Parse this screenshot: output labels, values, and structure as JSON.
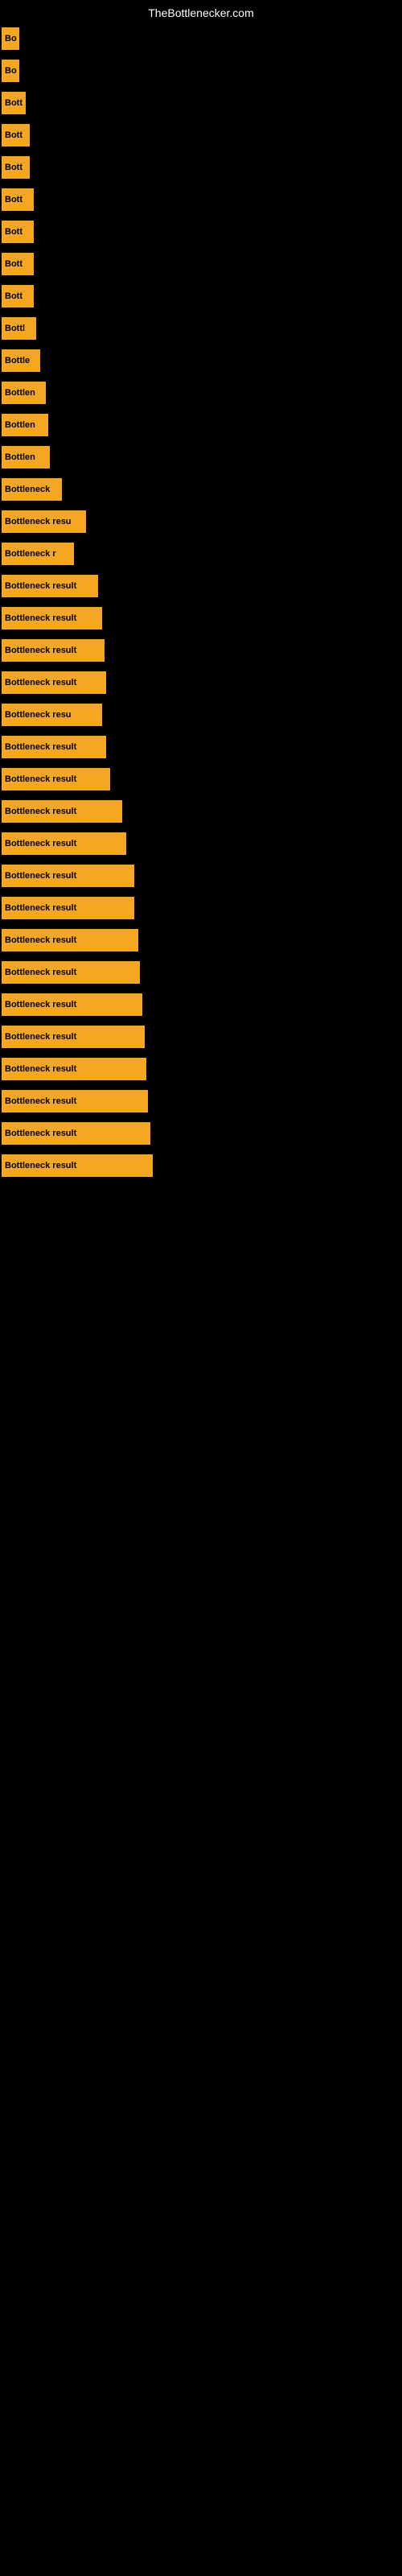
{
  "title": "TheBottlenecker.com",
  "bars": [
    {
      "label": "Bo",
      "width": 22
    },
    {
      "label": "Bo",
      "width": 22
    },
    {
      "label": "Bott",
      "width": 30
    },
    {
      "label": "Bott",
      "width": 35
    },
    {
      "label": "Bott",
      "width": 35
    },
    {
      "label": "Bott",
      "width": 40
    },
    {
      "label": "Bott",
      "width": 40
    },
    {
      "label": "Bott",
      "width": 40
    },
    {
      "label": "Bott",
      "width": 40
    },
    {
      "label": "Bottl",
      "width": 43
    },
    {
      "label": "Bottle",
      "width": 48
    },
    {
      "label": "Bottlen",
      "width": 55
    },
    {
      "label": "Bottlen",
      "width": 58
    },
    {
      "label": "Bottlen",
      "width": 60
    },
    {
      "label": "Bottleneck",
      "width": 75
    },
    {
      "label": "Bottleneck resu",
      "width": 105
    },
    {
      "label": "Bottleneck r",
      "width": 90
    },
    {
      "label": "Bottleneck result",
      "width": 120
    },
    {
      "label": "Bottleneck result",
      "width": 125
    },
    {
      "label": "Bottleneck result",
      "width": 128
    },
    {
      "label": "Bottleneck result",
      "width": 130
    },
    {
      "label": "Bottleneck resu",
      "width": 125
    },
    {
      "label": "Bottleneck result",
      "width": 130
    },
    {
      "label": "Bottleneck result",
      "width": 135
    },
    {
      "label": "Bottleneck result",
      "width": 150
    },
    {
      "label": "Bottleneck result",
      "width": 155
    },
    {
      "label": "Bottleneck result",
      "width": 165
    },
    {
      "label": "Bottleneck result",
      "width": 165
    },
    {
      "label": "Bottleneck result",
      "width": 170
    },
    {
      "label": "Bottleneck result",
      "width": 172
    },
    {
      "label": "Bottleneck result",
      "width": 175
    },
    {
      "label": "Bottleneck result",
      "width": 178
    },
    {
      "label": "Bottleneck result",
      "width": 180
    },
    {
      "label": "Bottleneck result",
      "width": 182
    },
    {
      "label": "Bottleneck result",
      "width": 185
    },
    {
      "label": "Bottleneck result",
      "width": 188
    }
  ]
}
